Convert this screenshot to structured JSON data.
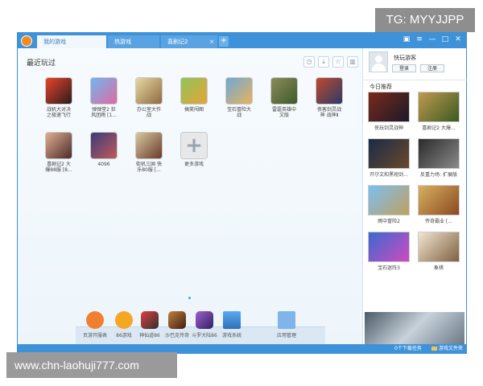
{
  "watermarks": {
    "top": "TG: MYYJJPP",
    "bottom": "www.chn-laohuji777.com"
  },
  "titlebar": {
    "tabs": [
      {
        "label": "我的游戏",
        "active": true
      },
      {
        "label": "热游戏",
        "active": false
      },
      {
        "label": "喜剧记2",
        "active": false
      }
    ],
    "add_tab": "+",
    "controls": {
      "skin": "▣",
      "menu": "≡",
      "minimize": "—",
      "maximize": "□",
      "close": "✕"
    }
  },
  "recent": {
    "title": "最近玩过",
    "tools": {
      "history": "◷",
      "download": "⤓",
      "favorite": "☆",
      "delete": "▥"
    },
    "games": [
      {
        "name": "战机大对决\n之极速飞行",
        "icon": "game-icon"
      },
      {
        "name": "弹弹堂2 狂\n风团雨 [1...",
        "icon": "game-icon"
      },
      {
        "name": "办公室大作\n战",
        "icon": "game-icon"
      },
      {
        "name": "搞笑闯图",
        "icon": "game-icon"
      },
      {
        "name": "宝石冒险大\n战",
        "icon": "game-icon"
      },
      {
        "name": "雷霆英雄中\n文版",
        "icon": "game-icon"
      },
      {
        "name": "侠客剑灵战\n神 战神Ⅱ",
        "icon": "game-icon"
      },
      {
        "name": "喜剧记2 大\n爆88服 [8...",
        "icon": "game-icon"
      },
      {
        "name": "4096",
        "icon": "game-icon"
      },
      {
        "name": "街机三国 快\n乐80服 [...",
        "icon": "game-icon"
      },
      {
        "name": "更多游戏",
        "icon": "plus-icon"
      }
    ]
  },
  "dock": [
    {
      "label": "页游开服表"
    },
    {
      "label": "86游戏"
    },
    {
      "label": "神仙道86"
    },
    {
      "label": "沙巴克传奇"
    },
    {
      "label": "斗罗大陆86"
    },
    {
      "label": "游戏系统"
    },
    {
      "label": "应用管理"
    }
  ],
  "sidebar": {
    "username": "快玩游客",
    "login": "登录",
    "register": "注册",
    "rec_title": "今日推荐",
    "recommends": [
      {
        "label": "侠玩剑灵战神"
      },
      {
        "label": "喜剧记2 大爆..."
      },
      {
        "label": "开尔文和黑袍剑..."
      },
      {
        "label": "反重力场: 扩展版"
      },
      {
        "label": "雨中冒险2"
      },
      {
        "label": "传奇霸业 [..."
      },
      {
        "label": "宝石迷阵3"
      },
      {
        "label": "象棋"
      }
    ]
  },
  "statusbar": {
    "tasks": "0个下载任务",
    "folder": "游戏文件夹"
  },
  "colors": {
    "accent": "#3e92d9",
    "window_bg": "#f1f7fc"
  }
}
